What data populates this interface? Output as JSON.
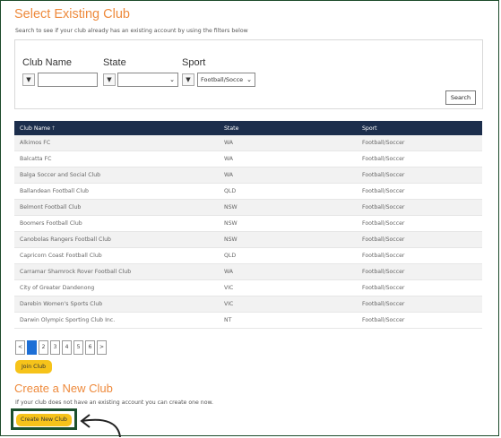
{
  "select": {
    "title": "Select Existing Club",
    "subtitle": "Search to see if your club already has an existing account by using the filters below"
  },
  "filters": {
    "club_name_label": "Club Name",
    "state_label": "State",
    "sport_label": "Sport",
    "club_name_value": "",
    "state_value": "",
    "sport_value": "Football/Socce",
    "filter_icon": "funnel-icon",
    "search_label": "Search"
  },
  "table": {
    "headers": {
      "club": "Club Name",
      "sort": "🡑",
      "state": "State",
      "sport": "Sport"
    },
    "rows": [
      {
        "club": "Alkimos FC",
        "state": "WA",
        "sport": "Football/Soccer"
      },
      {
        "club": "Balcatta FC",
        "state": "WA",
        "sport": "Football/Soccer"
      },
      {
        "club": "Balga Soccer and Social Club",
        "state": "WA",
        "sport": "Football/Soccer"
      },
      {
        "club": "Ballandean Football Club",
        "state": "QLD",
        "sport": "Football/Soccer"
      },
      {
        "club": "Belmont Football Club",
        "state": "NSW",
        "sport": "Football/Soccer"
      },
      {
        "club": "Boomers Football Club",
        "state": "NSW",
        "sport": "Football/Soccer"
      },
      {
        "club": "Canobolas Rangers Football Club",
        "state": "NSW",
        "sport": "Football/Soccer"
      },
      {
        "club": "Capricorn Coast Football Club",
        "state": "QLD",
        "sport": "Football/Soccer"
      },
      {
        "club": "Carramar Shamrock Rover Football Club",
        "state": "WA",
        "sport": "Football/Soccer"
      },
      {
        "club": "City of Greater Dandenong",
        "state": "VIC",
        "sport": "Football/Soccer"
      },
      {
        "club": "Darebin Women's Sports Club",
        "state": "VIC",
        "sport": "Football/Soccer"
      },
      {
        "club": "Darwin Olympic Sporting Club Inc.",
        "state": "NT",
        "sport": "Football/Soccer"
      }
    ]
  },
  "pagination": {
    "prev": "<",
    "pages": [
      "1",
      "2",
      "3",
      "4",
      "5",
      "6"
    ],
    "next": ">",
    "current": "1"
  },
  "join_label": "Join Club",
  "create": {
    "title": "Create a New Club",
    "subtitle": "If your club does not have an existing account you can create one now.",
    "button_label": "Create New Club"
  },
  "colors": {
    "accent": "#ee8a3c",
    "header": "#1c2e4c",
    "button": "#f6c31a",
    "highlight": "#1b4f2c"
  }
}
